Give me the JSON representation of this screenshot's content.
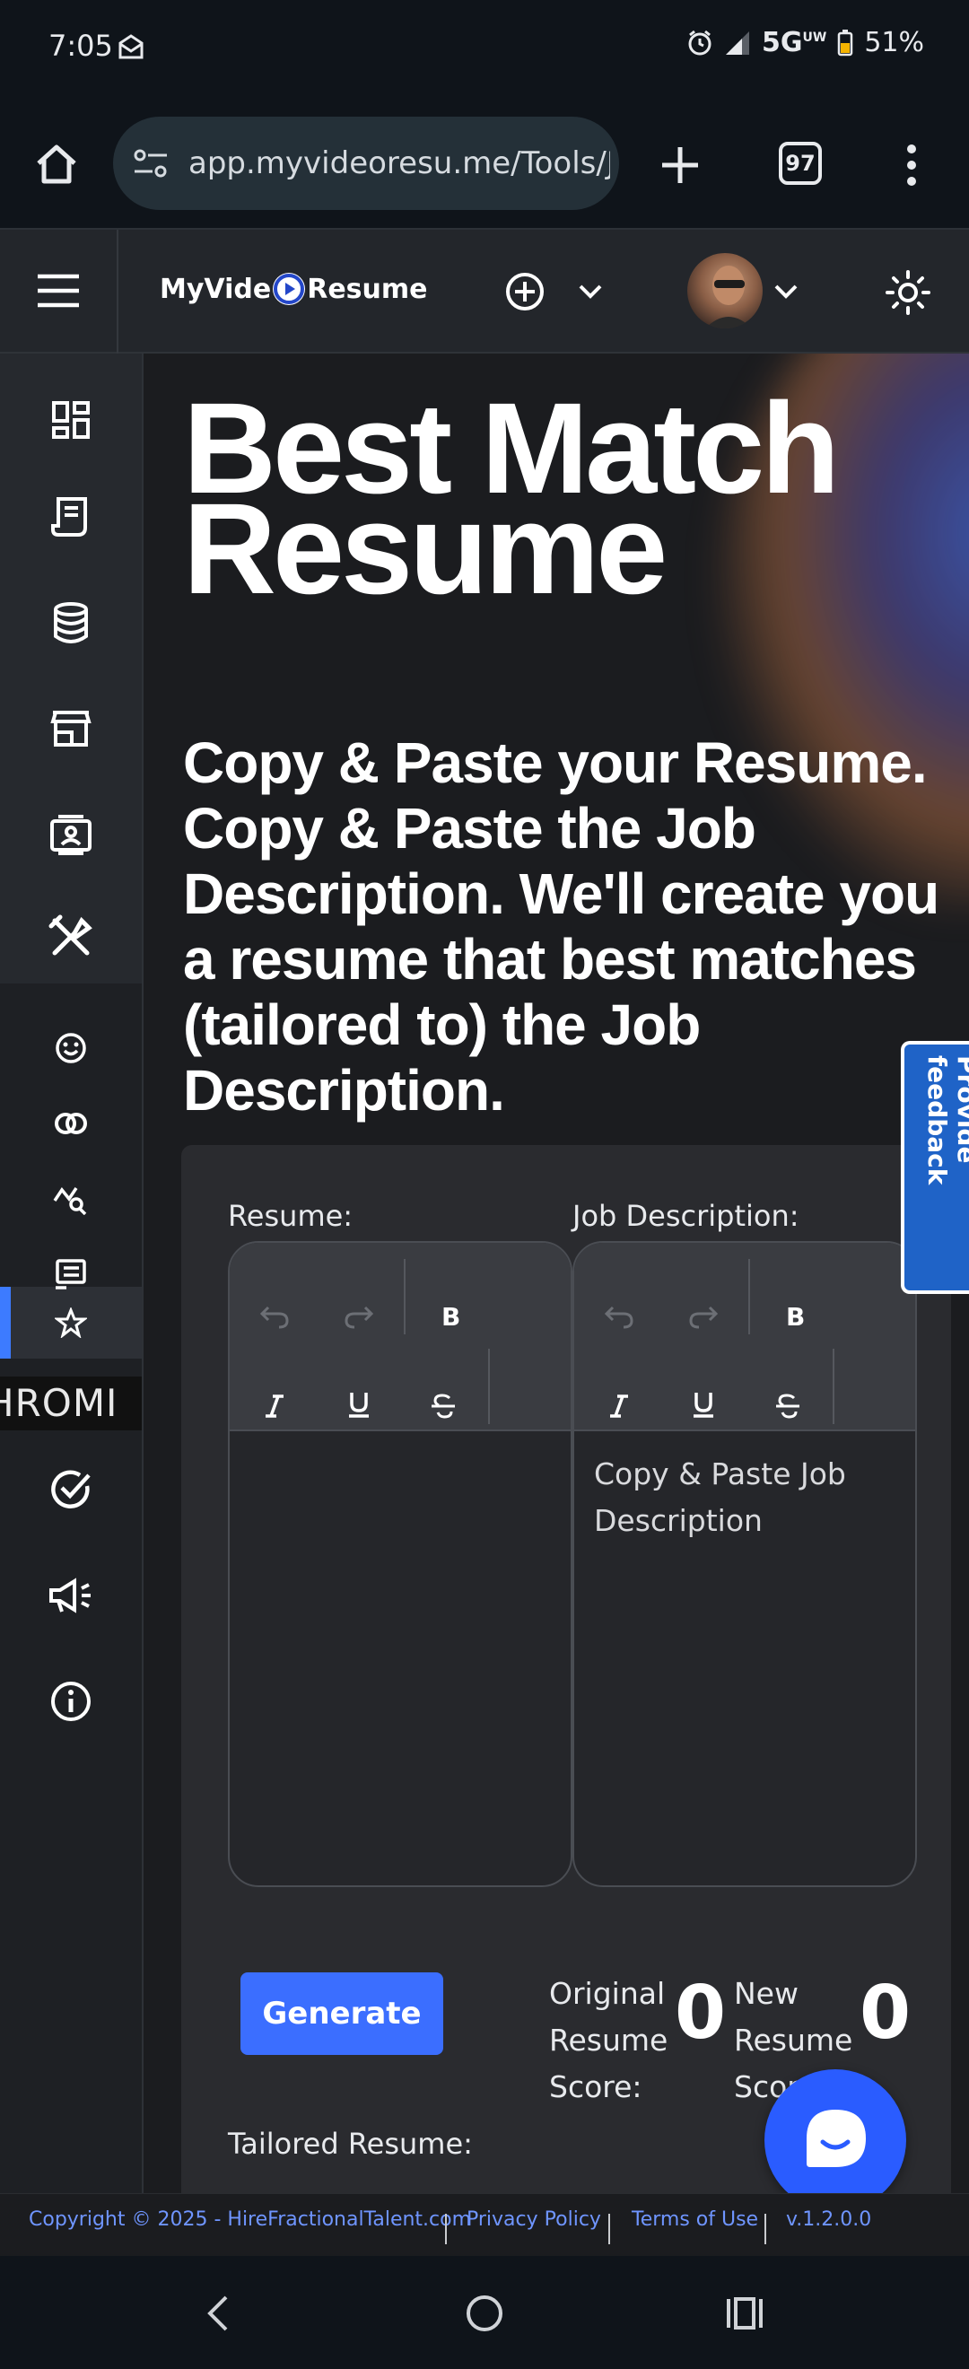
{
  "status_bar": {
    "time": "7:05",
    "network": "5G",
    "network_superscript": "UW",
    "battery": "51%"
  },
  "browser": {
    "url": "app.myvideoresu.me/Tools/J",
    "tab_count": "97"
  },
  "header": {
    "logo_text_left": "MyVide",
    "logo_text_right": "Resume",
    "brand_color": "#3b6eff"
  },
  "sidebar": {
    "items": [
      {
        "icon": "dashboard-icon"
      },
      {
        "icon": "document-icon"
      },
      {
        "icon": "database-icon"
      },
      {
        "icon": "store-icon"
      },
      {
        "icon": "contact-card-icon"
      },
      {
        "icon": "tools-icon"
      },
      {
        "icon": "smiley-icon"
      },
      {
        "icon": "overlap-circles-icon"
      },
      {
        "icon": "chart-search-icon"
      },
      {
        "icon": "resume-list-icon"
      },
      {
        "icon": "star-icon",
        "active": true
      },
      {
        "icon": "check-circle-icon"
      },
      {
        "icon": "megaphone-icon"
      },
      {
        "icon": "info-icon"
      }
    ],
    "chrome_label": "HROMI"
  },
  "main": {
    "title": "Best Match Resume",
    "subtitle": "Copy & Paste your Resume. Copy & Paste the Job Description. We'll create you a resume that best matches (tailored to) the Job Description.",
    "resume_label": "Resume:",
    "job_label": "Job Description:",
    "resume_placeholder": "",
    "job_placeholder": "Copy & Paste Job Description",
    "generate_label": "Generate",
    "original_score_label_1": "Original",
    "original_score_label_2": "Resume",
    "original_score_label_3": "Score:",
    "original_score": "0",
    "new_score_label_1": "New",
    "new_score_label_2": "Resume",
    "new_score_label_3": "Score:",
    "new_score": "0",
    "tailored_label": "Tailored Resume:",
    "feedback_label": "Provide feedback"
  },
  "footer": {
    "copyright": "Copyright © 2025 - HireFractionalTalent.com",
    "privacy": "Privacy Policy",
    "terms": "Terms of Use",
    "version": "v.1.2.0.0"
  }
}
